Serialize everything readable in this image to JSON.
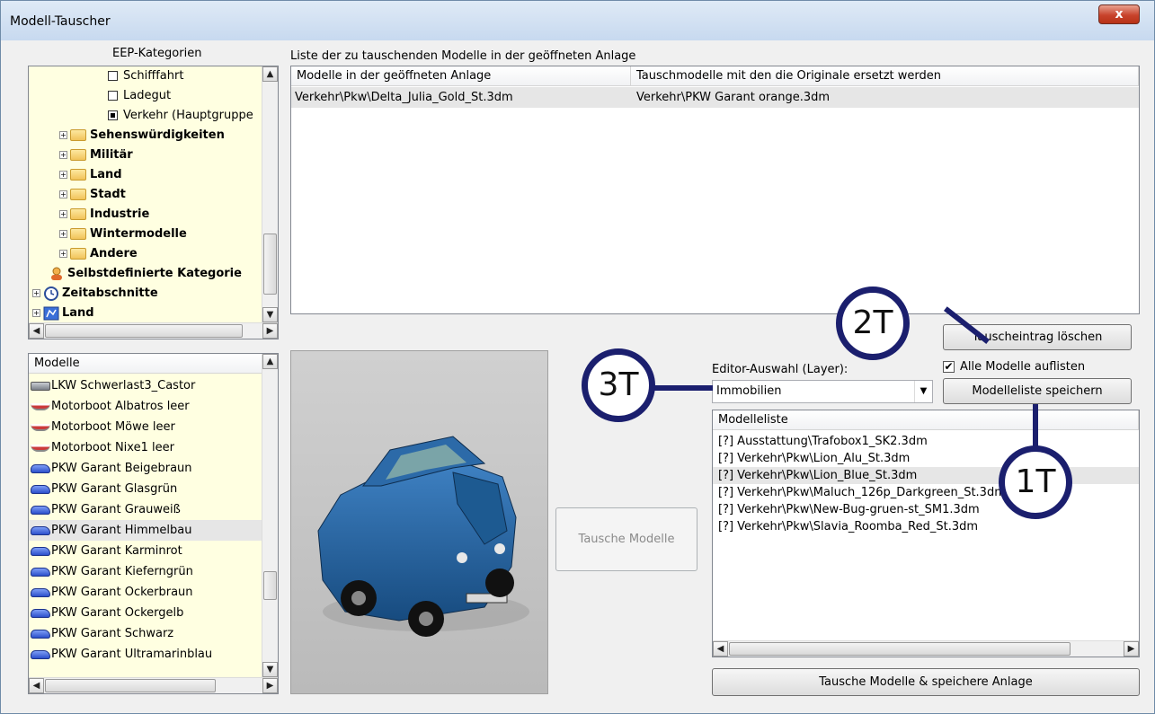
{
  "window": {
    "title": "Modell-Tauscher",
    "close_label": "x"
  },
  "category_tree": {
    "header": "EEP-Kategorien",
    "items": [
      {
        "label": "Schifffahrt",
        "kind": "checkbox",
        "checked": false,
        "bold": false
      },
      {
        "label": "Ladegut",
        "kind": "checkbox",
        "checked": false,
        "bold": false
      },
      {
        "label": "Verkehr (Hauptgruppe",
        "kind": "checkbox",
        "checked": true,
        "bold": false
      },
      {
        "label": "Sehenswürdigkeiten",
        "kind": "folder",
        "bold": true
      },
      {
        "label": "Militär",
        "kind": "folder",
        "bold": true
      },
      {
        "label": "Land",
        "kind": "folder",
        "bold": true
      },
      {
        "label": "Stadt",
        "kind": "folder",
        "bold": true
      },
      {
        "label": "Industrie",
        "kind": "folder",
        "bold": true
      },
      {
        "label": "Wintermodelle",
        "kind": "folder",
        "bold": true
      },
      {
        "label": "Andere",
        "kind": "folder",
        "bold": true
      },
      {
        "label": "Selbstdefinierte Kategorie",
        "kind": "user",
        "bold": true
      },
      {
        "label": "Zeitabschnitte",
        "kind": "clock",
        "bold": true
      },
      {
        "label": "Land",
        "kind": "map",
        "bold": true
      }
    ]
  },
  "swap_list": {
    "header": "Liste der zu tauschenden Modelle in der geöffneten Anlage",
    "columns": [
      "Modelle in der geöffneten Anlage",
      "Tauschmodelle mit den die Originale ersetzt werden"
    ],
    "rows": [
      [
        "Verkehr\\Pkw\\Delta_Julia_Gold_St.3dm",
        "Verkehr\\PKW Garant orange.3dm"
      ]
    ]
  },
  "models": {
    "header": "Modelle",
    "items": [
      {
        "label": "LKW Schwerlast3_Castor",
        "icon": "truck-icon"
      },
      {
        "label": "Motorboot Albatros leer",
        "icon": "boat-icon"
      },
      {
        "label": "Motorboot Möwe leer",
        "icon": "boat-icon"
      },
      {
        "label": "Motorboot Nixe1 leer",
        "icon": "boat-icon"
      },
      {
        "label": "PKW Garant Beigebraun",
        "icon": "car-icon"
      },
      {
        "label": "PKW Garant Glasgrün",
        "icon": "car-icon"
      },
      {
        "label": "PKW Garant Grauweiß",
        "icon": "car-icon"
      },
      {
        "label": "PKW Garant Himmelbau",
        "icon": "car-icon",
        "selected": true
      },
      {
        "label": "PKW Garant Karminrot",
        "icon": "car-icon"
      },
      {
        "label": "PKW Garant Kieferngrün",
        "icon": "car-icon"
      },
      {
        "label": "PKW Garant Ockerbraun",
        "icon": "car-icon"
      },
      {
        "label": "PKW Garant Ockergelb",
        "icon": "car-icon"
      },
      {
        "label": "PKW Garant Schwarz",
        "icon": "car-icon"
      },
      {
        "label": "PKW Garant Ultramarinblau",
        "icon": "car-icon"
      }
    ]
  },
  "actions": {
    "swap_models": "Tausche Modelle",
    "delete_entry": "Tauscheintrag löschen",
    "list_all": "Alle Modelle auflisten",
    "list_all_checked": true,
    "save_list": "Modelleliste speichern",
    "swap_and_save": "Tausche Modelle & speichere Anlage"
  },
  "editor": {
    "label": "Editor-Auswahl (Layer):",
    "selected": "Immobilien"
  },
  "model_list": {
    "header": "Modelleliste",
    "items": [
      "[?] Ausstattung\\Trafobox1_SK2.3dm",
      "[?] Verkehr\\Pkw\\Lion_Alu_St.3dm",
      "[?] Verkehr\\Pkw\\Lion_Blue_St.3dm",
      "[?] Verkehr\\Pkw\\Maluch_126p_Darkgreen_St.3dm",
      "[?] Verkehr\\Pkw\\New-Bug-gruen-st_SM1.3dm",
      "[?] Verkehr\\Pkw\\Slavia_Roomba_Red_St.3dm"
    ],
    "selected_index": 2
  },
  "callouts": {
    "c1": "1T",
    "c2": "2T",
    "c3": "3T"
  },
  "colors": {
    "tree_bg": "#ffffe1",
    "callout_ring": "#1b1f6e",
    "car_body": "#1f5f9e"
  }
}
